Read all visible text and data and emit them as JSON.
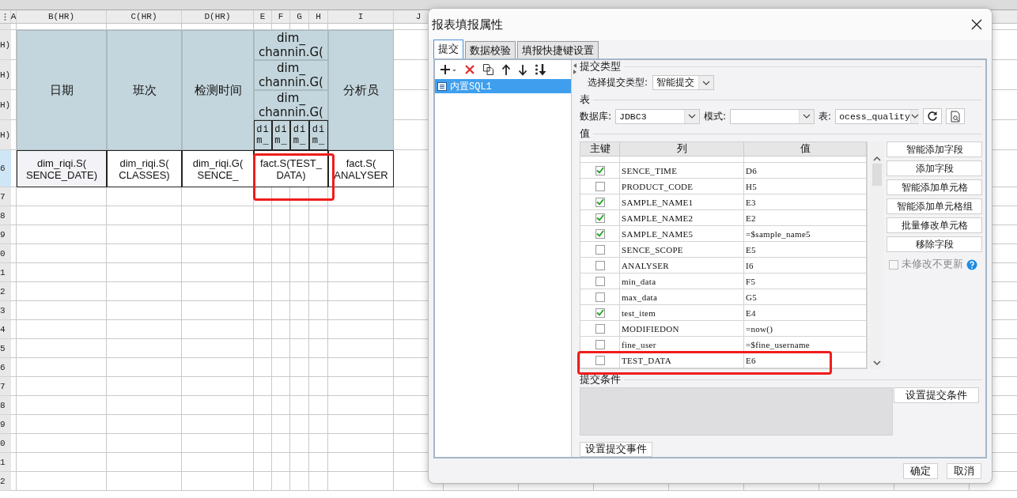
{
  "sheet": {
    "columns": [
      "A",
      "B(HR)",
      "C(HR)",
      "D(HR)",
      "E",
      "F",
      "G",
      "H",
      "I",
      "J"
    ],
    "row_headers": [
      "H)",
      "H)",
      "H)",
      "H)",
      "6",
      "7",
      "8",
      "9",
      "0",
      "1",
      "2",
      "3",
      "4",
      "5",
      "6",
      "7",
      "8",
      "9",
      "0",
      "1",
      "2"
    ],
    "cells": [
      {
        "kind": "header",
        "text": "日期"
      },
      {
        "kind": "header",
        "text": "班次"
      },
      {
        "kind": "header",
        "text": "检测时间"
      },
      {
        "kind": "header",
        "text": "dim_\nchannin.G("
      },
      {
        "kind": "header",
        "text": "dim_\nchannin.G("
      },
      {
        "kind": "header",
        "text": "dim_\nchannin.G("
      },
      {
        "kind": "narrow",
        "text": "di\nm_"
      },
      {
        "kind": "narrow",
        "text": "di\nm_"
      },
      {
        "kind": "narrow",
        "text": "di\nm_"
      },
      {
        "kind": "narrow",
        "text": "di\nm_"
      },
      {
        "kind": "header",
        "text": "分析员"
      },
      {
        "kind": "data",
        "text": "dim_riqi.S(\nSENCE_DATE)",
        "selected": true
      },
      {
        "kind": "data",
        "text": "dim_riqi.S(\nCLASSES)",
        "selected": false
      },
      {
        "kind": "data",
        "text": "dim_riqi.G(\nSENCE_",
        "selected": false
      },
      {
        "kind": "data",
        "text": "fact.S(TEST_\nDATA)",
        "selected": false
      },
      {
        "kind": "data",
        "text": "fact.S(\nANALYSER",
        "selected": false
      }
    ]
  },
  "dialog": {
    "title": "报表填报属性",
    "tabs": [
      {
        "label": "提交",
        "selected": true
      },
      {
        "label": "数据校验",
        "selected": false
      },
      {
        "label": "填报快捷键设置",
        "selected": false
      }
    ],
    "tree": [
      {
        "label": "内置SQL1",
        "selected": true
      }
    ],
    "submit_type": {
      "heading": "提交类型",
      "label": "选择提交类型:",
      "value": "智能提交"
    },
    "table_section": {
      "heading": "表",
      "database_label": "数据库:",
      "database": "JDBC3",
      "schema_label": "模式:",
      "table_label": "表:",
      "table": "ocess_quality"
    },
    "values": {
      "heading": "值",
      "columns": [
        "主键",
        "列",
        "值"
      ],
      "rows": [
        {
          "checked": true,
          "column": "SENCE_TIME",
          "value": "D6"
        },
        {
          "checked": false,
          "column": "PRODUCT_CODE",
          "value": "H5"
        },
        {
          "checked": true,
          "column": "SAMPLE_NAME1",
          "value": "E3"
        },
        {
          "checked": true,
          "column": "SAMPLE_NAME2",
          "value": "E2"
        },
        {
          "checked": true,
          "column": "SAMPLE_NAME5",
          "value": "=$sample_name5"
        },
        {
          "checked": false,
          "column": "SENCE_SCOPE",
          "value": "E5"
        },
        {
          "checked": false,
          "column": "ANALYSER",
          "value": "I6"
        },
        {
          "checked": false,
          "column": "min_data",
          "value": "F5"
        },
        {
          "checked": false,
          "column": "max_data",
          "value": "G5"
        },
        {
          "checked": true,
          "column": "test_item",
          "value": "E4"
        },
        {
          "checked": false,
          "column": "MODIFIEDON",
          "value": "=now()"
        },
        {
          "checked": false,
          "column": "fine_user",
          "value": "=$fine_username"
        },
        {
          "checked": false,
          "column": "TEST_DATA",
          "value": "E6"
        }
      ]
    },
    "actions": [
      "智能添加字段",
      "添加字段",
      "智能添加单元格",
      "智能添加单元格组",
      "批量修改单元格",
      "移除字段"
    ],
    "skip_unmodified": {
      "label": "未修改不更新",
      "checked": false,
      "disabled": true
    },
    "condition": {
      "heading": "提交条件",
      "button": "设置提交条件"
    },
    "event_button": "设置提交事件",
    "footer": [
      "确定",
      "取消"
    ]
  }
}
